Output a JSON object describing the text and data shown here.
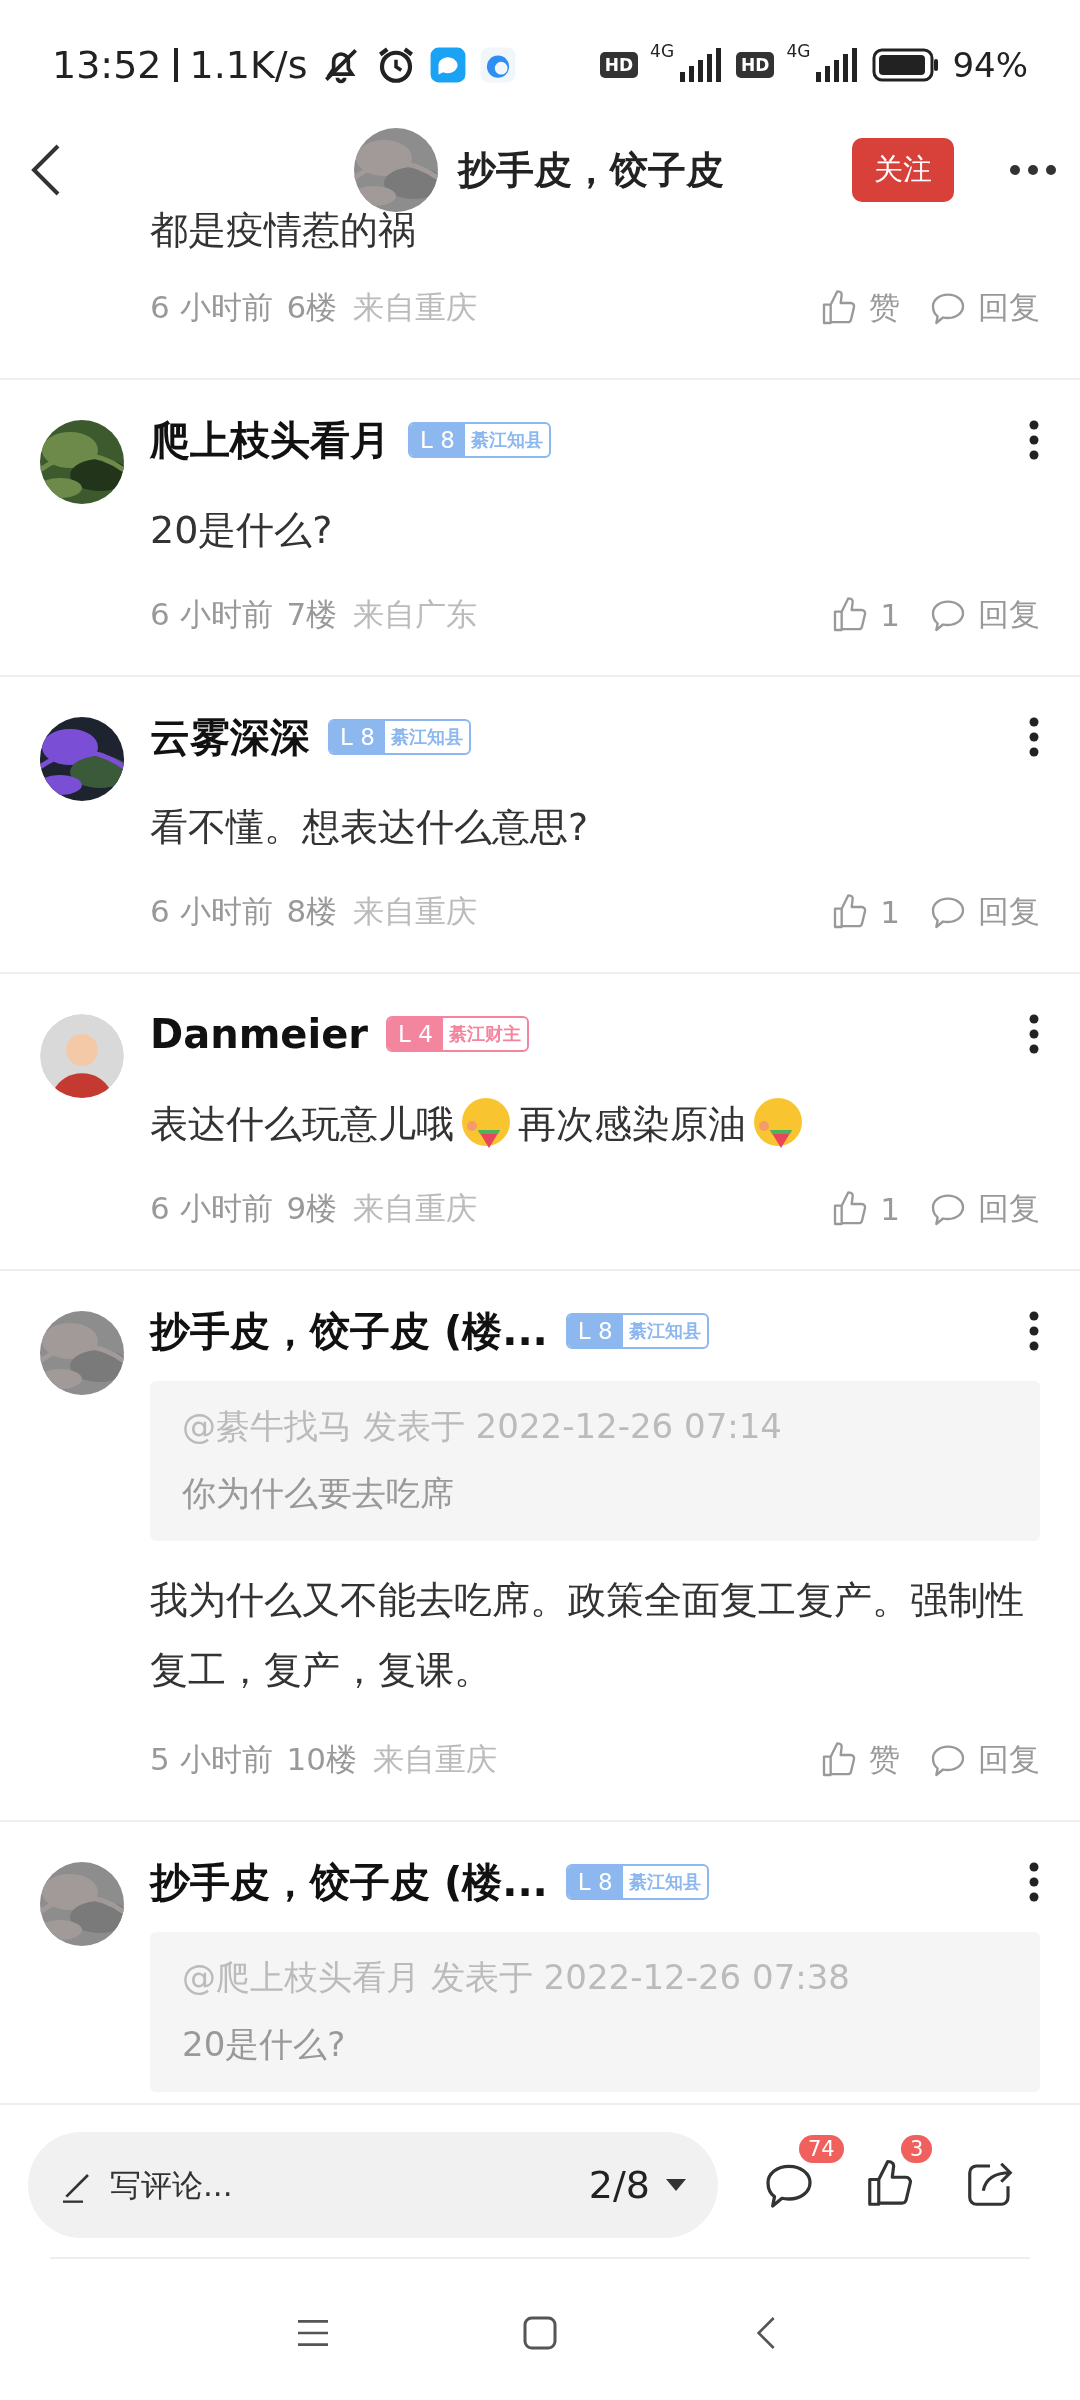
{
  "status_bar": {
    "time": "13:52",
    "speed": "1.1K/s",
    "sims": [
      {
        "hd": "HD",
        "net": "4G"
      },
      {
        "hd": "HD",
        "net": "4G"
      }
    ],
    "battery": "94%"
  },
  "header": {
    "title": "抄手皮，饺子皮",
    "follow_button": "关注"
  },
  "partial_comment": {
    "text": "都是疫情惹的祸",
    "time": "6 小时前",
    "floor": "6楼",
    "location": "来自重庆",
    "like": "赞",
    "reply": "回复"
  },
  "comments": [
    {
      "author": "爬上枝头看月",
      "avatar": {
        "kind": "picture"
      },
      "badge": {
        "level": "L 8",
        "title": "綦江知县",
        "color": "#8db7ef"
      },
      "content": [
        {
          "kind": "text",
          "text": "20是什么?"
        }
      ],
      "time": "6 小时前",
      "floor": "7楼",
      "location": "来自广东",
      "like": "1",
      "reply": "回复"
    },
    {
      "author": "云雾深深",
      "avatar": {
        "kind": "picture"
      },
      "badge": {
        "level": "L 8",
        "title": "綦江知县",
        "color": "#8db7ef"
      },
      "content": [
        {
          "kind": "text",
          "text": "看不懂。想表达什么意思?"
        }
      ],
      "time": "6 小时前",
      "floor": "8楼",
      "location": "来自重庆",
      "like": "1",
      "reply": "回复"
    },
    {
      "author": "Danmeier",
      "avatar": {
        "kind": "cartoon"
      },
      "badge": {
        "level": "L 4",
        "title": "綦江财主",
        "color": "#f4859f"
      },
      "content": [
        {
          "kind": "text",
          "text": "表达什么玩意儿哦"
        },
        {
          "kind": "emoji"
        },
        {
          "kind": "text",
          "text": "再次感染原油"
        },
        {
          "kind": "emoji"
        }
      ],
      "time": "6 小时前",
      "floor": "9楼",
      "location": "来自重庆",
      "like": "1",
      "reply": "回复"
    },
    {
      "author": "抄手皮，饺子皮 (楼...",
      "avatar": {
        "kind": "picture"
      },
      "badge": {
        "level": "L 8",
        "title": "綦江知县",
        "color": "#8db7ef"
      },
      "quote": {
        "source": "@綦牛找马 发表于 2022-12-26 07:14",
        "text": "你为什么要去吃席"
      },
      "content": [
        {
          "kind": "text",
          "text": "我为什么又不能去吃席。政策全面复工复产。强制性复工，复产，复课。"
        }
      ],
      "time": "5 小时前",
      "floor": "10楼",
      "location": "来自重庆",
      "like": "赞",
      "reply": "回复"
    },
    {
      "author": "抄手皮，饺子皮 (楼...",
      "avatar": {
        "kind": "picture"
      },
      "badge": {
        "level": "L 8",
        "title": "綦江知县",
        "color": "#8db7ef"
      },
      "quote": {
        "source": "@爬上枝头看月 发表于 2022-12-26 07:38",
        "text": "20是什么?"
      }
    }
  ],
  "composer": {
    "placeholder": "写评论...",
    "page": "2/8"
  },
  "actions": [
    {
      "kind": "comment",
      "badge": "74"
    },
    {
      "kind": "like",
      "badge": "3"
    },
    {
      "kind": "share"
    }
  ],
  "nav": [
    {
      "kind": "menu"
    },
    {
      "kind": "home"
    },
    {
      "kind": "back"
    }
  ]
}
